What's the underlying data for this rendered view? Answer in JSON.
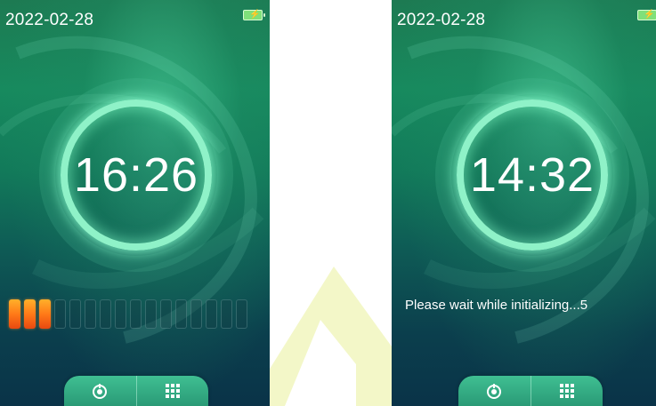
{
  "screens": [
    {
      "date": "2022-02-28",
      "time": "16:26",
      "progress": {
        "total_segments": 16,
        "filled_segments": 3
      },
      "dock": {
        "left_icon": "power-icon",
        "right_icon": "grid-menu-icon"
      }
    },
    {
      "date": "2022-02-28",
      "time": "14:32",
      "status_message": "Please wait while initializing...5",
      "dock": {
        "left_icon": "power-icon",
        "right_icon": "grid-menu-icon"
      }
    }
  ],
  "colors": {
    "progress_filled": "#ff7a18",
    "ring": "#8ff2c8",
    "battery": "#7fe07a"
  }
}
